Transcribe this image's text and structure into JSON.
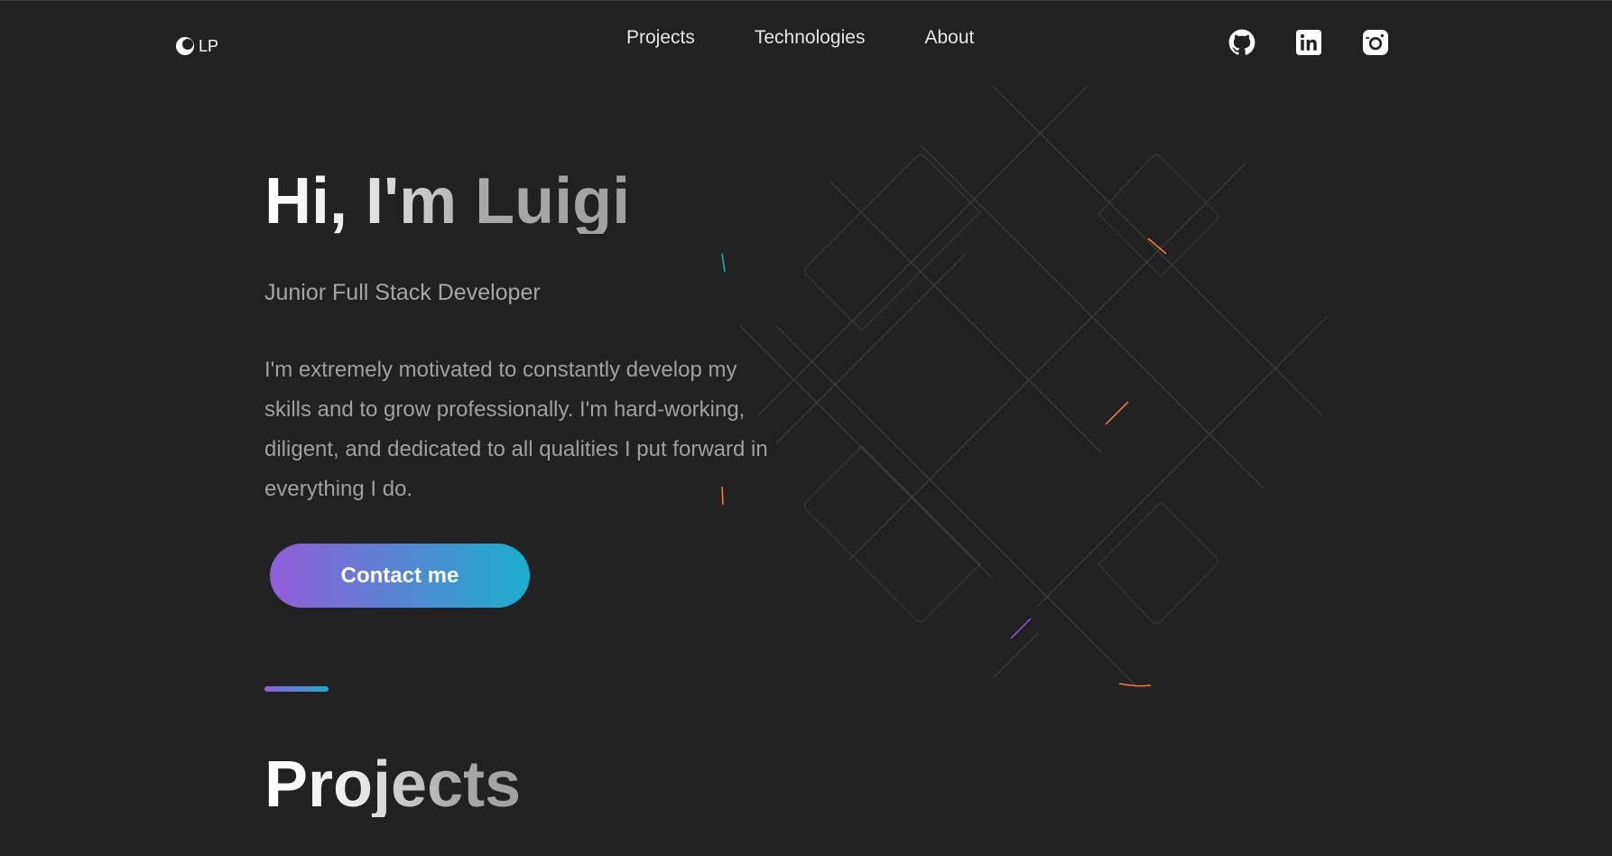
{
  "header": {
    "logo_text": "LP",
    "nav": [
      {
        "label": "Projects"
      },
      {
        "label": "Technologies"
      },
      {
        "label": "About"
      }
    ],
    "socials": [
      {
        "icon": "github-icon"
      },
      {
        "icon": "linkedin-icon"
      },
      {
        "icon": "instagram-icon"
      }
    ]
  },
  "hero": {
    "title": "Hi, I'm Luigi",
    "role": "Junior Full Stack Developer",
    "bio": "I'm extremely motivated to constantly develop my skills and to grow professionally. I'm hard-working, diligent, and dedicated to all qualities I put forward in everything I do.",
    "contact_label": "Contact me"
  },
  "projects": {
    "title": "Projects"
  },
  "colors": {
    "background": "#212121",
    "gradient_start": "#925ddb",
    "gradient_end": "#1aaecb"
  }
}
